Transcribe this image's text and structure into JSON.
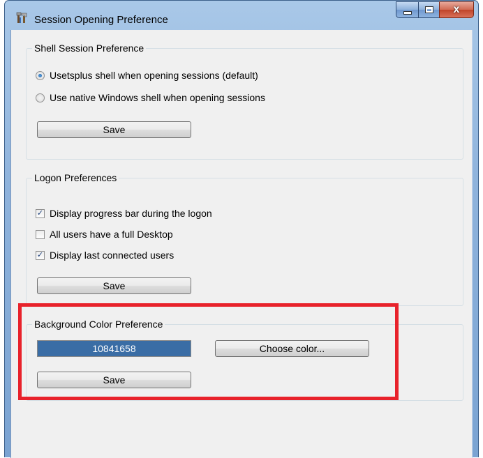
{
  "window": {
    "title": "Session Opening Preference",
    "close_glyph": "x"
  },
  "icons": {
    "app": "tools-icon",
    "minimize": "minimize-icon",
    "maximize": "maximize-icon",
    "close": "close-icon"
  },
  "shell_group": {
    "legend": "Shell Session Preference",
    "options": [
      {
        "label": "Usetsplus shell when opening sessions (default)",
        "checked": true
      },
      {
        "label": "Use native Windows shell when opening sessions",
        "checked": false
      }
    ],
    "save_label": "Save"
  },
  "logon_group": {
    "legend": "Logon Preferences",
    "options": [
      {
        "label": "Display progress bar during the logon",
        "checked": true
      },
      {
        "label": "All users have a full Desktop",
        "checked": false
      },
      {
        "label": "Display last connected users",
        "checked": true
      }
    ],
    "save_label": "Save"
  },
  "background_group": {
    "legend": "Background Color Preference",
    "color_value": "10841658",
    "color_hex": "#3a6da5",
    "choose_label": "Choose color...",
    "save_label": "Save"
  },
  "colors": {
    "highlight": "#e8222b",
    "window_frame": "#8fb3dc",
    "client_bg": "#f0f0f0"
  }
}
